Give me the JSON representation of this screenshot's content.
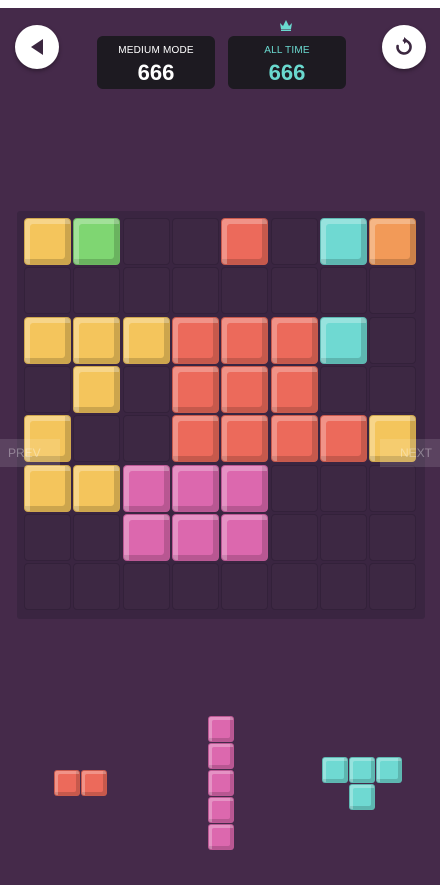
{
  "header": {
    "back_icon": "back-triangle-icon",
    "restart_icon": "restart-icon",
    "crown_icon": "crown-icon",
    "current": {
      "label": "MEDIUM MODE",
      "value": "666"
    },
    "best": {
      "label": "ALL TIME",
      "value": "666"
    }
  },
  "nav": {
    "prev_label": "PREV",
    "next_label": "NEXT"
  },
  "colors": {
    "yellow": "#f4c55c",
    "green": "#7fd672",
    "red": "#ec6a5b",
    "cyan": "#6fd9d2",
    "orange": "#f29a58",
    "pink": "#dc68ae",
    "best_accent": "#6ad9cf"
  },
  "board": {
    "size": 8,
    "rows": [
      [
        "yellow",
        "green",
        null,
        null,
        "red",
        null,
        "cyan",
        "orange"
      ],
      [
        null,
        null,
        null,
        null,
        null,
        null,
        null,
        null
      ],
      [
        "yellow",
        "yellow",
        "yellow",
        "red",
        "red",
        "red",
        "cyan",
        null
      ],
      [
        null,
        "yellow",
        null,
        "red",
        "red",
        "red",
        null,
        null
      ],
      [
        "yellow",
        null,
        null,
        "red",
        "red",
        "red",
        "red",
        "yellow"
      ],
      [
        "yellow",
        "yellow",
        "pink",
        "pink",
        "pink",
        null,
        null,
        null
      ],
      [
        null,
        null,
        "pink",
        "pink",
        "pink",
        null,
        null,
        null
      ],
      [
        null,
        null,
        null,
        null,
        null,
        null,
        null,
        null
      ]
    ]
  },
  "tray": [
    {
      "name": "tray-piece-red-horizontal-2",
      "color": "red",
      "cells": [
        [
          0,
          0
        ],
        [
          0,
          1
        ]
      ]
    },
    {
      "name": "tray-piece-pink-vertical-5",
      "color": "pink",
      "cells": [
        [
          0,
          0
        ],
        [
          1,
          0
        ],
        [
          2,
          0
        ],
        [
          3,
          0
        ],
        [
          4,
          0
        ]
      ]
    },
    {
      "name": "tray-piece-cyan-t-shape",
      "color": "cyan",
      "cells": [
        [
          0,
          0
        ],
        [
          0,
          1
        ],
        [
          0,
          2
        ],
        [
          1,
          1
        ]
      ]
    }
  ]
}
